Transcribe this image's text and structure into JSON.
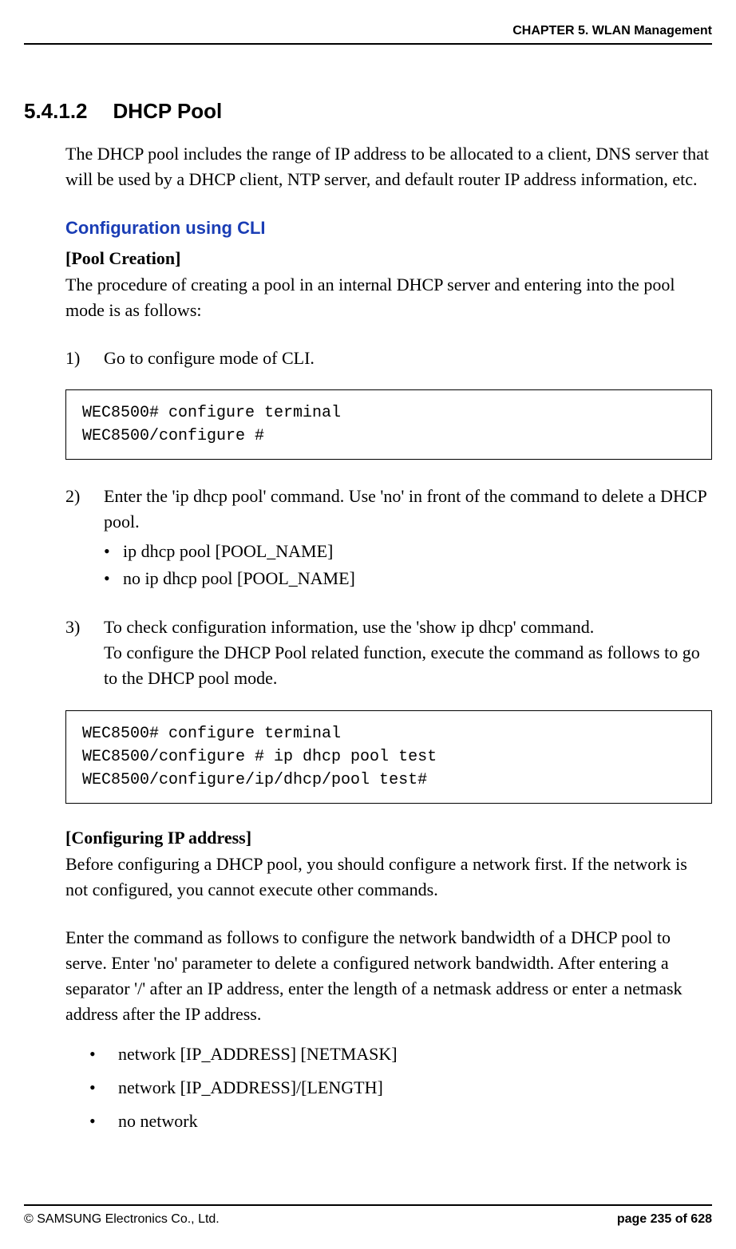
{
  "header": {
    "chapter": "CHAPTER 5. WLAN Management"
  },
  "section": {
    "number": "5.4.1.2",
    "title": "DHCP Pool",
    "intro": "The DHCP pool includes the range of IP address to be allocated to a client, DNS server that will be used by a DHCP client, NTP server, and default router IP address information, etc."
  },
  "config_cli": {
    "heading": "Configuration using CLI",
    "pool_creation": {
      "label": "[Pool Creation]",
      "desc": "The procedure of creating a pool in an internal DHCP server and entering into the pool mode is as follows:",
      "step1": {
        "num": "1)",
        "text": "Go to configure mode of CLI."
      },
      "code1": "WEC8500# configure terminal\nWEC8500/configure #",
      "step2": {
        "num": "2)",
        "text": "Enter the 'ip dhcp pool' command. Use 'no' in front of the command to delete a DHCP pool.",
        "bullets": [
          "ip dhcp pool [POOL_NAME]",
          "no ip dhcp pool [POOL_NAME]"
        ]
      },
      "step3": {
        "num": "3)",
        "text": "To check configuration information, use the 'show ip dhcp' command.\nTo configure the DHCP Pool related function, execute the command as follows to go to the DHCP pool mode."
      },
      "code2": "WEC8500# configure terminal\nWEC8500/configure # ip dhcp pool test\nWEC8500/configure/ip/dhcp/pool test#"
    },
    "config_ip": {
      "label": "[Configuring IP address]",
      "desc1": "Before configuring a DHCP pool, you should configure a network first. If the network is not configured, you cannot execute other commands.",
      "desc2": "Enter the command as follows to configure the network bandwidth of a DHCP pool to serve. Enter 'no' parameter to delete a configured network bandwidth. After entering a separator '/' after an IP address, enter the length of a netmask address or enter a netmask address after the IP address.",
      "bullets": [
        "network [IP_ADDRESS] [NETMASK]",
        "network [IP_ADDRESS]/[LENGTH]",
        "no network"
      ]
    }
  },
  "footer": {
    "copyright": "© SAMSUNG Electronics Co., Ltd.",
    "page": "page 235 of 628"
  }
}
